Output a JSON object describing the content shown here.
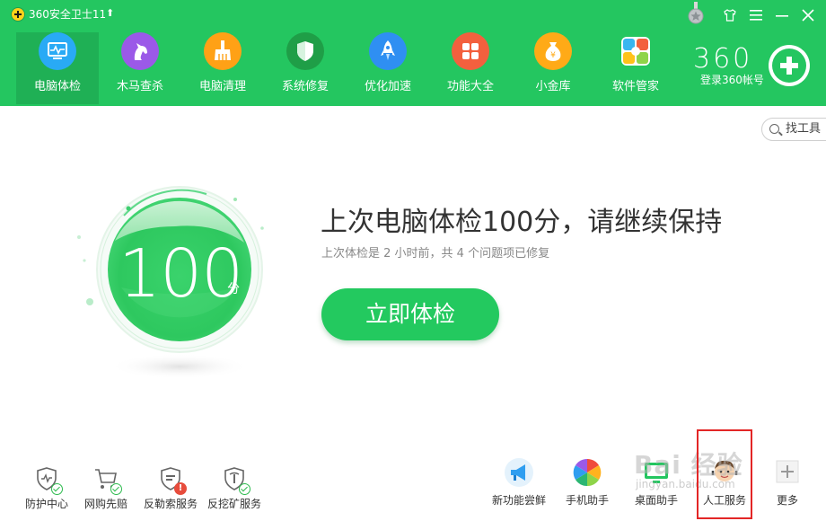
{
  "window": {
    "title": "360安全卫士11",
    "controls": [
      "shirt-icon",
      "menu-icon",
      "minimize-icon",
      "close-icon"
    ]
  },
  "nav": {
    "items": [
      {
        "label": "电脑体检",
        "icon": "monitor-check-icon",
        "color": "#29aaf5",
        "active": true
      },
      {
        "label": "木马查杀",
        "icon": "horse-icon",
        "color": "#9b59e8",
        "active": false
      },
      {
        "label": "电脑清理",
        "icon": "broom-icon",
        "color": "#ffa116",
        "active": false
      },
      {
        "label": "系统修复",
        "icon": "shield-icon",
        "color": "#1f9e47",
        "active": false
      },
      {
        "label": "优化加速",
        "icon": "rocket-icon",
        "color": "#2f8ff2",
        "active": false
      },
      {
        "label": "功能大全",
        "icon": "grid-icon",
        "color": "#f3603e",
        "active": false
      },
      {
        "label": "小金库",
        "icon": "money-bag-icon",
        "color": "#ffaa17",
        "active": false
      },
      {
        "label": "软件管家",
        "icon": "software-icon",
        "color": "#2bb0e8",
        "active": false
      }
    ]
  },
  "account": {
    "brand": "360",
    "login_label": "登录360帐号"
  },
  "tools": {
    "find_label": "找工具"
  },
  "score": {
    "value": "100",
    "unit": "分"
  },
  "main": {
    "headline": "上次电脑体检100分，请继续保持",
    "subline": "上次体检是 2 小时前，共 4 个问题项已修复",
    "check_button": "立即体检"
  },
  "bottom_left": [
    {
      "label": "防护中心",
      "icon": "protection-center-icon",
      "badge": "check"
    },
    {
      "label": "网购先赔",
      "icon": "shopping-cart-icon",
      "badge": "check"
    },
    {
      "label": "反勒索服务",
      "icon": "anti-ransom-icon",
      "badge": "warn"
    },
    {
      "label": "反挖矿服务",
      "icon": "anti-mining-icon",
      "badge": "check"
    }
  ],
  "bottom_right": [
    {
      "label": "新功能尝鲜",
      "icon": "megaphone-icon"
    },
    {
      "label": "手机助手",
      "icon": "phone-assistant-icon"
    },
    {
      "label": "桌面助手",
      "icon": "desktop-assistant-icon"
    },
    {
      "label": "人工服务",
      "icon": "customer-service-icon"
    },
    {
      "label": "更多",
      "icon": "more-plus-icon"
    }
  ],
  "watermark": {
    "text": "Bai 经验",
    "sub": "jingyan.baidu.com"
  },
  "colors": {
    "header": "#24c660",
    "accent": "#23c95f",
    "highlight_box": "#e32626"
  }
}
